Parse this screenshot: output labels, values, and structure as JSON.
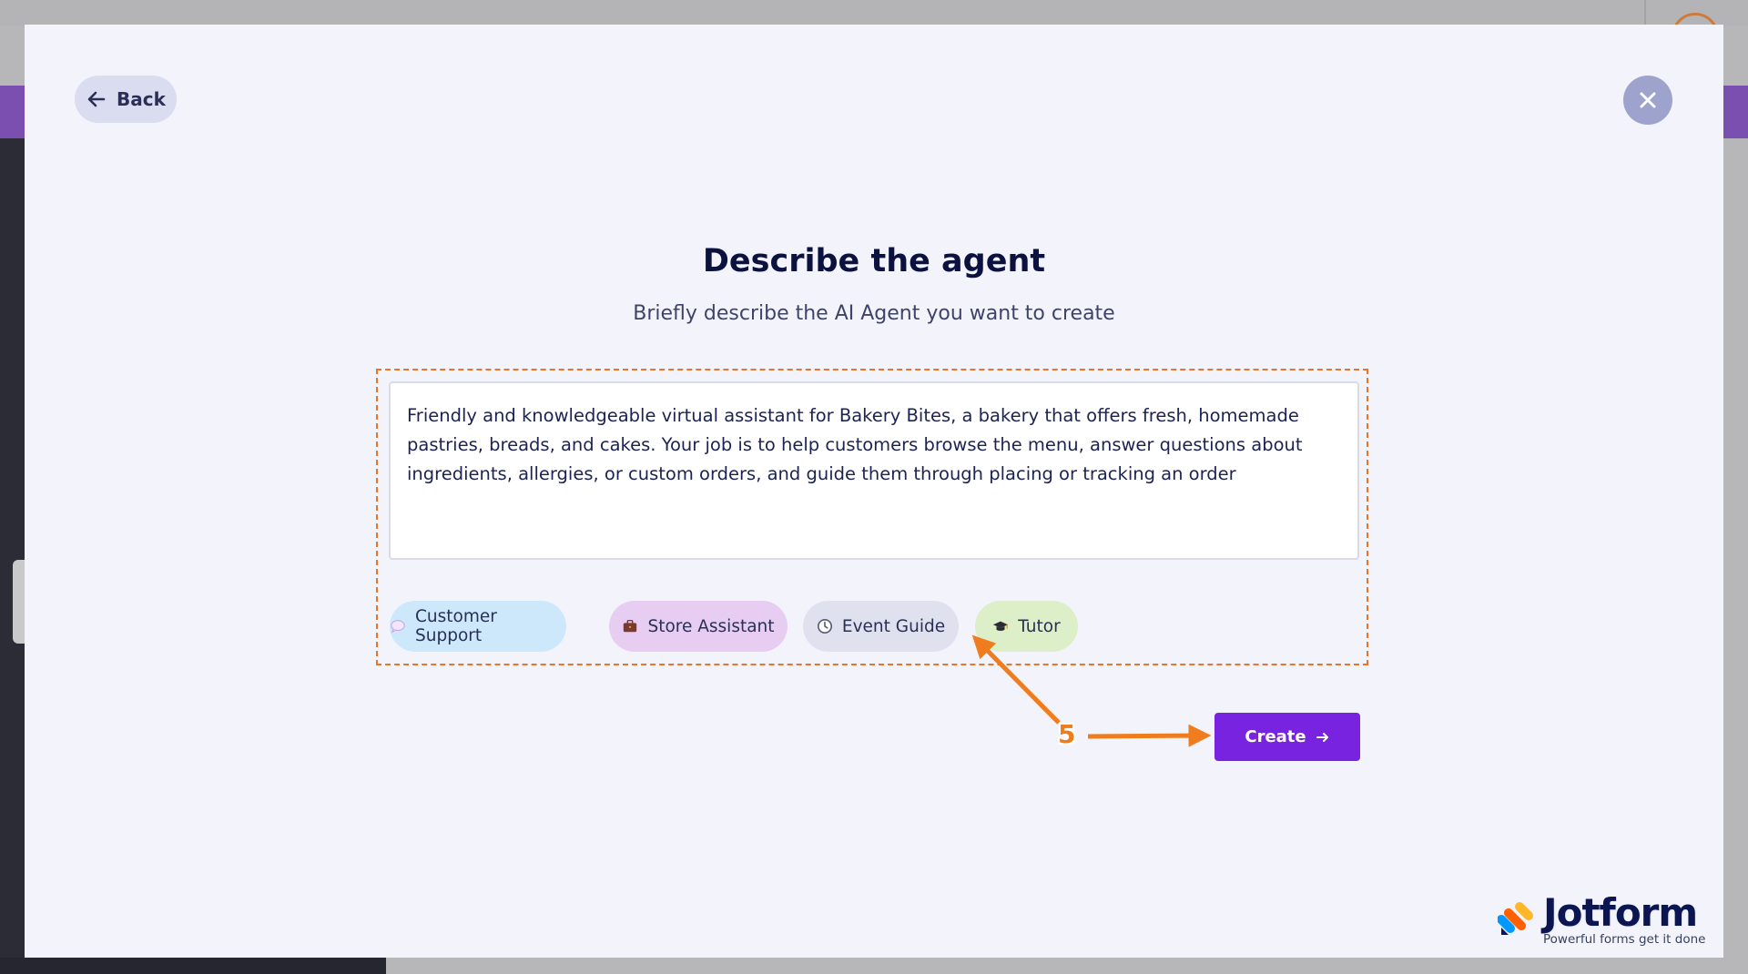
{
  "modal": {
    "back_label": "Back",
    "title": "Describe the agent",
    "subtitle": "Briefly describe the AI Agent you want to create",
    "description": "Friendly and knowledgeable virtual assistant for Bakery Bites, a bakery that offers fresh, homemade pastries, breads, and cakes. Your job is to help customers browse the menu, answer questions about ingredients, allergies, or custom orders, and guide them through placing or tracking an order",
    "chips": [
      {
        "label": "Customer Support",
        "icon": "speech-bubble-icon",
        "color": "#cde7fb"
      },
      {
        "label": "Store Assistant",
        "icon": "briefcase-icon",
        "color": "#e8cdf2"
      },
      {
        "label": "Event Guide",
        "icon": "clock-icon",
        "color": "#dfe1ee"
      },
      {
        "label": "Tutor",
        "icon": "graduation-cap-icon",
        "color": "#dcefc8"
      }
    ],
    "create_label": "Create",
    "accent_color": "#7823e0"
  },
  "annotation": {
    "step_number": "5",
    "color": "#ef7c1d"
  },
  "branding": {
    "name": "Jotform",
    "tagline": "Powerful forms get it done"
  }
}
